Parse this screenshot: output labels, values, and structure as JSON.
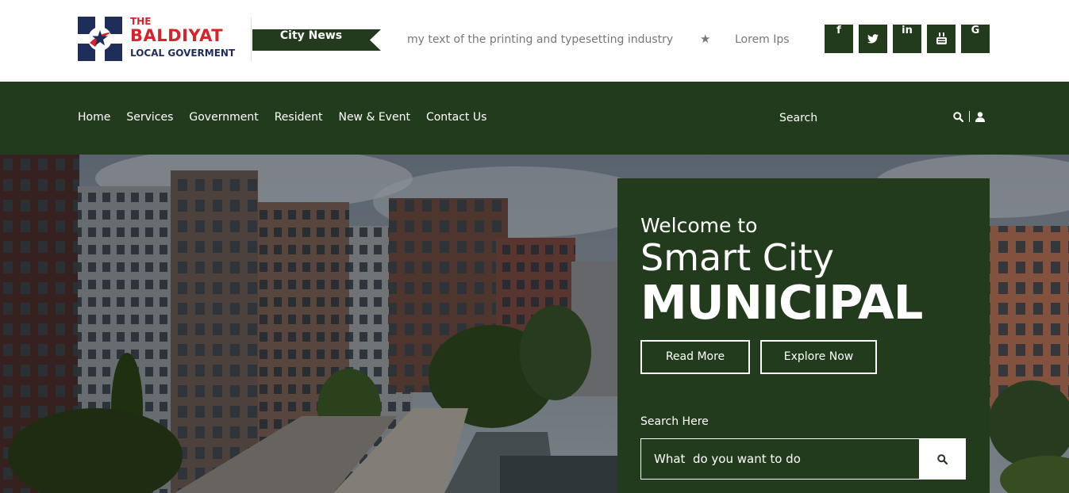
{
  "logo": {
    "the": "THE",
    "name": "BALDIYAT",
    "subtitle": "LOCAL GOVERMENT"
  },
  "ticker": {
    "label": "City News",
    "text": "my text of the printing and typesetting industry",
    "text2": "Lorem Ips"
  },
  "social": [
    {
      "icon": "facebook-icon",
      "glyph": "f"
    },
    {
      "icon": "twitter-icon",
      "glyph": "t"
    },
    {
      "icon": "linkedin-icon",
      "glyph": "in"
    },
    {
      "icon": "youtube-icon",
      "glyph": "▶"
    },
    {
      "icon": "google-icon",
      "glyph": "G"
    }
  ],
  "nav": {
    "items": [
      "Home",
      "Services",
      "Government",
      "Resident",
      "New & Event",
      "Contact Us"
    ],
    "search": "Search"
  },
  "hero": {
    "welcome": "Welcome to",
    "smart": "Smart City",
    "municipal": "MUNICIPAL",
    "read_more": "Read More",
    "explore_now": "Explore Now",
    "search_label": "Search Here",
    "search_placeholder": "What  do you want to do"
  },
  "colors": {
    "primary": "#233b1d",
    "accent": "#d8232a",
    "navy": "#1f2d5a"
  }
}
